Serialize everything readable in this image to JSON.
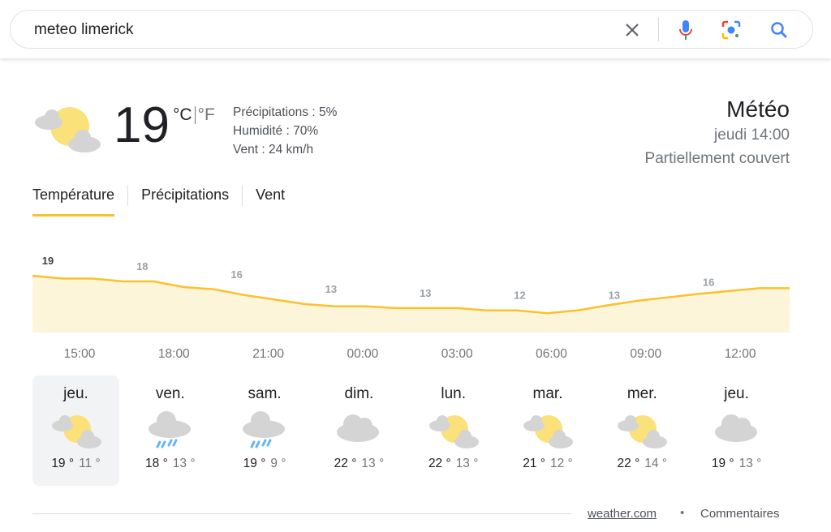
{
  "search": {
    "query": "meteo limerick",
    "icons": [
      "close-icon",
      "microphone-icon",
      "lens-icon",
      "search-icon"
    ]
  },
  "current": {
    "temp": "19",
    "unit_c": "°C",
    "unit_f": "°F",
    "precip": "Précipitations : 5%",
    "humidity": "Humidité : 70%",
    "wind": "Vent : 24 km/h",
    "icon": "partly-cloudy-icon"
  },
  "header": {
    "title": "Météo",
    "time": "jeudi 14:00",
    "condition": "Partiellement couvert"
  },
  "tabs": [
    {
      "label": "Température",
      "active": true
    },
    {
      "label": "Précipitations"
    },
    {
      "label": "Vent"
    }
  ],
  "chart_data": {
    "type": "area",
    "color": "#fbc02d",
    "fill": "#fdf5d9",
    "hourly_temps": [
      19,
      18.5,
      18.5,
      18,
      18,
      17,
      16.6,
      15.6,
      14.8,
      14,
      13.6,
      13.6,
      13.3,
      13.3,
      13.3,
      12.9,
      12.9,
      12.4,
      12.9,
      13.8,
      14.6,
      15.2,
      15.8,
      16.3,
      16.8,
      16.8
    ],
    "labels": [
      "19",
      "18",
      "16",
      "13",
      "13",
      "12",
      "13",
      "16"
    ],
    "times": [
      "15:00",
      "18:00",
      "21:00",
      "00:00",
      "03:00",
      "06:00",
      "09:00",
      "12:00"
    ]
  },
  "days": [
    {
      "name": "jeu.",
      "hi": "19 °",
      "lo": "11 °",
      "icon": "partly-cloudy",
      "selected": true
    },
    {
      "name": "ven.",
      "hi": "18 °",
      "lo": "13 °",
      "icon": "rain"
    },
    {
      "name": "sam.",
      "hi": "19 °",
      "lo": "9 °",
      "icon": "rain"
    },
    {
      "name": "dim.",
      "hi": "22 °",
      "lo": "13 °",
      "icon": "cloudy"
    },
    {
      "name": "lun.",
      "hi": "22 °",
      "lo": "13 °",
      "icon": "partly-cloudy"
    },
    {
      "name": "mar.",
      "hi": "21 °",
      "lo": "12 °",
      "icon": "partly-cloudy"
    },
    {
      "name": "mer.",
      "hi": "22 °",
      "lo": "14 °",
      "icon": "partly-cloudy"
    },
    {
      "name": "jeu.",
      "hi": "19 °",
      "lo": "13 °",
      "icon": "cloudy"
    }
  ],
  "footer": {
    "source": "weather.com",
    "separator": "•",
    "feedback": "Commentaires"
  }
}
